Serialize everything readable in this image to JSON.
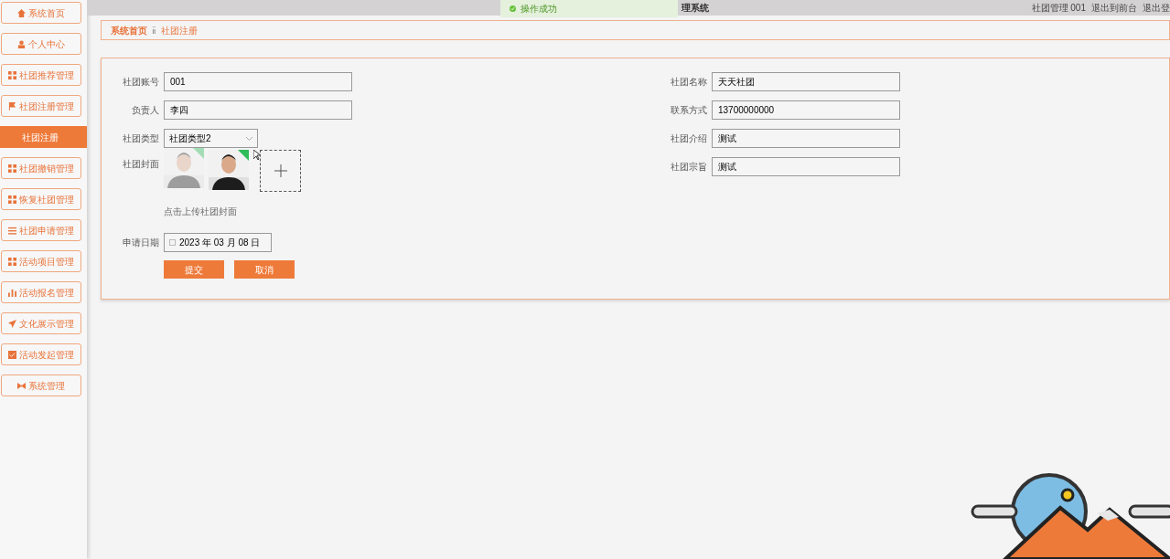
{
  "topbar": {
    "title": "理系统",
    "user": "社团管理 001",
    "links": [
      "退出到前台",
      "退出登"
    ]
  },
  "toast": {
    "text": "操作成功"
  },
  "sidebar": {
    "items": [
      {
        "label": "系统首页",
        "kind": "home",
        "selected": false
      },
      {
        "label": "个人中心",
        "kind": "user",
        "selected": false
      },
      {
        "label": "社团推荐管理",
        "kind": "grid",
        "selected": false
      },
      {
        "label": "社团注册管理",
        "kind": "flag",
        "selected": false
      },
      {
        "label": "社团注册",
        "kind": "sub",
        "selected": true
      },
      {
        "label": "社团撤销管理",
        "kind": "grid",
        "selected": false
      },
      {
        "label": "恢复社团管理",
        "kind": "grid",
        "selected": false
      },
      {
        "label": "社团申请管理",
        "kind": "list",
        "selected": false
      },
      {
        "label": "活动项目管理",
        "kind": "grid",
        "selected": false
      },
      {
        "label": "活动报名管理",
        "kind": "chart",
        "selected": false
      },
      {
        "label": "文化展示管理",
        "kind": "send",
        "selected": false
      },
      {
        "label": "活动发起管理",
        "kind": "check",
        "selected": false
      },
      {
        "label": "系统管理",
        "kind": "bowtie",
        "selected": false
      }
    ]
  },
  "breadcrumb": {
    "items": [
      "系统首页",
      "社团注册"
    ],
    "separator": "ⅱ"
  },
  "form": {
    "left": [
      {
        "kind": "text",
        "label": "社团账号",
        "value": "001"
      },
      {
        "kind": "text",
        "label": "负责人",
        "value": "李四"
      },
      {
        "kind": "select",
        "label": "社团类型",
        "value": "社团类型2"
      },
      {
        "kind": "upload",
        "label": "社团封面",
        "hint": "点击上传社团封面"
      },
      {
        "kind": "date",
        "label": "申请日期",
        "value": "2023 年 03 月 08 日"
      }
    ],
    "right": [
      {
        "kind": "text",
        "label": "社团名称",
        "value": "天天社团"
      },
      {
        "kind": "text",
        "label": "联系方式",
        "value": "13700000000"
      },
      {
        "kind": "text",
        "label": "社团介绍",
        "value": "测试"
      },
      {
        "kind": "text",
        "label": "社团宗旨",
        "value": "测试"
      }
    ],
    "buttons": [
      "提交",
      "取消"
    ]
  }
}
